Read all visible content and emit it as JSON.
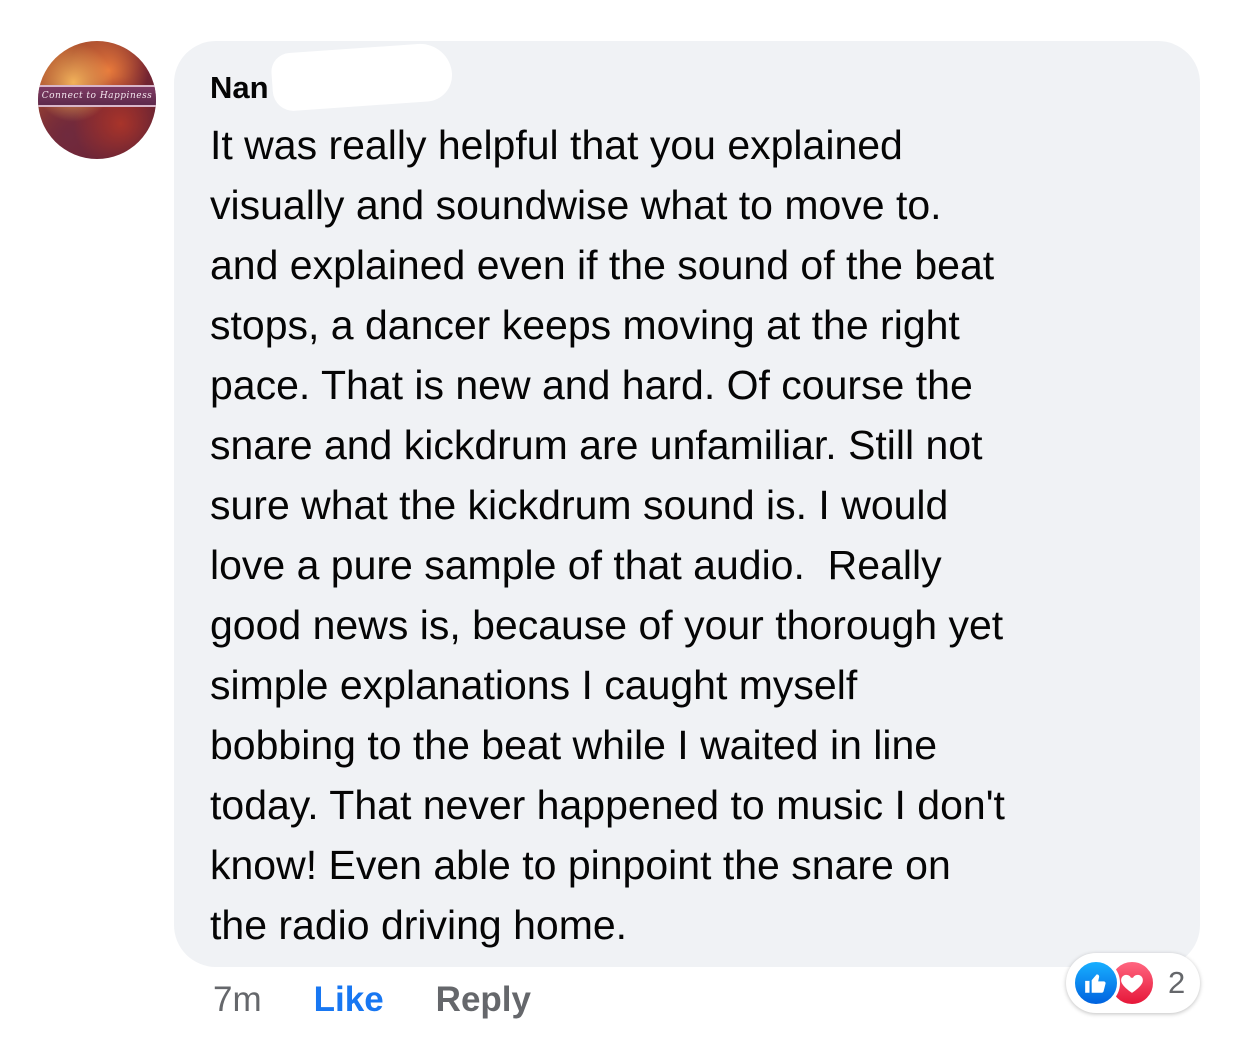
{
  "comment": {
    "author_name": "Nan",
    "avatar_text": "Connect to Happiness",
    "lines": [
      "It was really helpful that you explained",
      "visually and soundwise what to move to.",
      "and explained even if the sound of the beat",
      "stops, a dancer keeps moving at the right",
      "pace. That is new and hard. Of course the",
      "snare and kickdrum are unfamiliar. Still not",
      "sure what the kickdrum sound is. I would",
      "love a pure sample of that audio.  Really",
      "good news is, because of your thorough yet",
      "simple explanations I caught myself",
      "bobbing to the beat while I waited in line",
      "today. That never happened to music I don't",
      "know! Even able to pinpoint the snare on",
      "the radio driving home."
    ],
    "timestamp": "7m",
    "like_label": "Like",
    "reply_label": "Reply",
    "reactions": {
      "icons": [
        "like-icon",
        "love-icon"
      ],
      "count": "2"
    }
  },
  "colors": {
    "bubble": "#f0f2f5",
    "text": "#050505",
    "secondary_text": "#65676b",
    "like_blue": "#1877f2",
    "love_red": "#e61739"
  }
}
